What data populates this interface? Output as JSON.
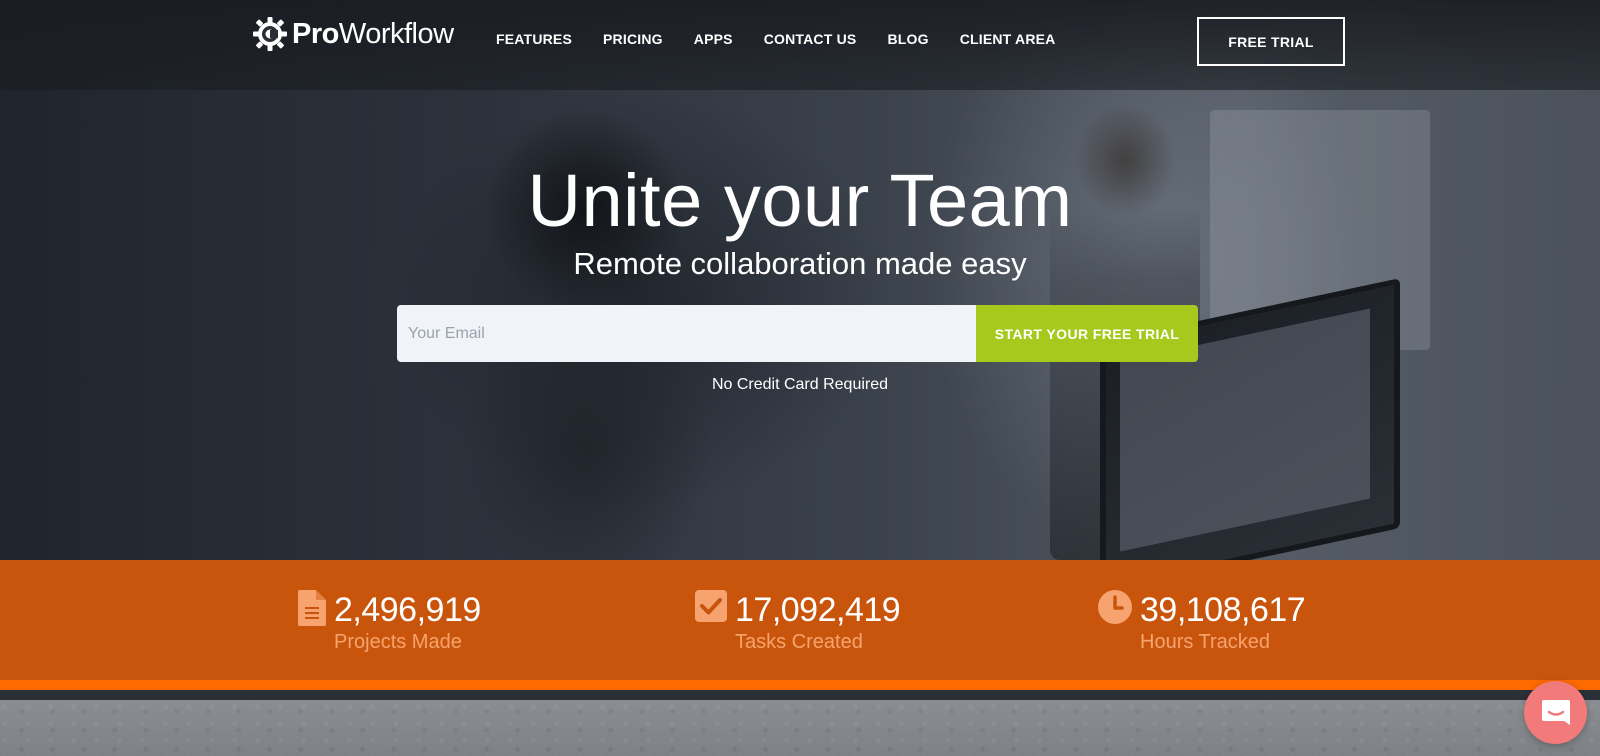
{
  "brand": {
    "logo_bold": "Pro",
    "logo_light": "Workflow",
    "logo_icon": "gear-icon"
  },
  "nav": {
    "items": [
      {
        "label": "FEATURES"
      },
      {
        "label": "PRICING"
      },
      {
        "label": "APPS"
      },
      {
        "label": "CONTACT US"
      },
      {
        "label": "BLOG"
      },
      {
        "label": "CLIENT AREA"
      }
    ],
    "cta_label": "FREE TRIAL"
  },
  "hero": {
    "headline": "Unite your Team",
    "subheadline": "Remote collaboration made easy",
    "email_placeholder": "Your Email",
    "start_button": "START YOUR FREE TRIAL",
    "note": "No Credit Card Required"
  },
  "stats": [
    {
      "icon": "document-icon",
      "value": "2,496,919",
      "label": "Projects Made"
    },
    {
      "icon": "checkbox-icon",
      "value": "17,092,419",
      "label": "Tasks Created"
    },
    {
      "icon": "clock-icon",
      "value": "39,108,617",
      "label": "Hours Tracked"
    }
  ],
  "chat": {
    "icon": "chat-bubble-icon"
  },
  "colors": {
    "accent_green": "#a5c91c",
    "stats_band": "#c9550c",
    "stats_stripe": "#ff6a00",
    "stat_label": "#f6a36f",
    "chat_button": "#f27a7a"
  }
}
